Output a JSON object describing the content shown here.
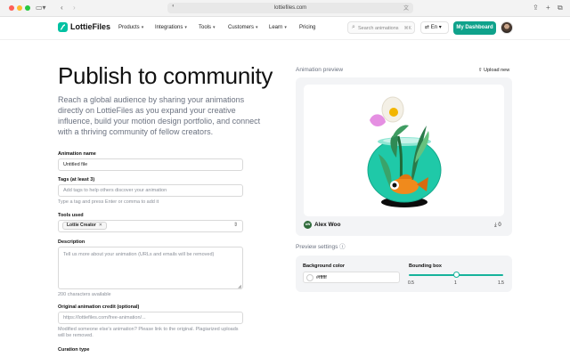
{
  "browser": {
    "url": "lottiefiles.com"
  },
  "nav": {
    "logo": "LottieFiles",
    "items": [
      {
        "label": "Products",
        "chevron": "▾"
      },
      {
        "label": "Integrations",
        "chevron": "▾"
      },
      {
        "label": "Tools",
        "chevron": "▾"
      },
      {
        "label": "Customers",
        "chevron": "▾"
      },
      {
        "label": "Learn",
        "chevron": "▾"
      },
      {
        "label": "Pricing",
        "chevron": ""
      }
    ],
    "search_placeholder": "Search animations",
    "search_shortcut": "⌘K",
    "language": "En",
    "dashboard_button": "My Dashboard"
  },
  "page": {
    "title": "Publish to community",
    "lead": "Reach a global audience by sharing your animations directly on LottieFiles as you expand your creative influence, build your motion design portfolio, and connect with a thriving community of fellow creators."
  },
  "form": {
    "animation_name": {
      "label": "Animation name",
      "value": "Untitled file"
    },
    "tags": {
      "label": "Tags (at least 3)",
      "placeholder": "Add tags to help others discover your animation",
      "help": "Type a tag and press Enter or comma to add it"
    },
    "tools": {
      "label": "Tools used",
      "chip": "Lottie Creator"
    },
    "description": {
      "label": "Description",
      "placeholder": "Tell us more about your animation (URLs and emails will be removed)",
      "help": "200 characters available"
    },
    "credit": {
      "label": "Original animation credit (optional)",
      "placeholder": "https://lottiefiles.com/free-animation/...",
      "help": "Modified someone else's animation? Please link to the original. Plagiarized uploads will be removed."
    },
    "curation": {
      "label": "Curation type"
    }
  },
  "preview": {
    "label": "Animation preview",
    "upload_new": "Upload new",
    "author_initials": "AW",
    "author": "Alex Woo",
    "downloads": "0"
  },
  "settings": {
    "label": "Preview settings",
    "background_label": "Background color",
    "background_value": "#ffffff",
    "bounding_label": "Bounding box",
    "bounding_ticks": [
      "0.5",
      "1",
      "1.5"
    ],
    "bounding_value": 1
  },
  "colors": {
    "brand": "#00c1a2",
    "button": "#0fa28b",
    "slider": "#16b39b"
  }
}
